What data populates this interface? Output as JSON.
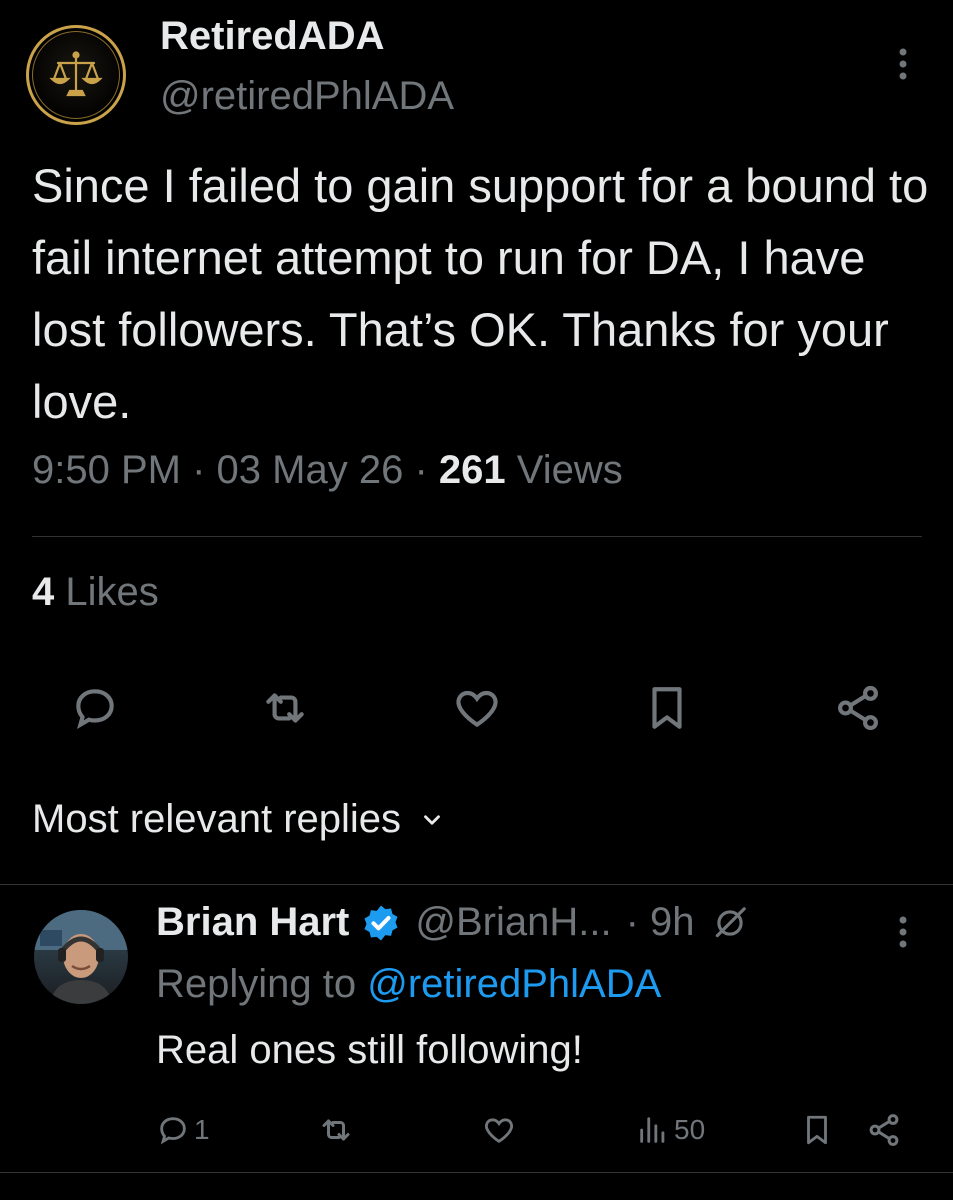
{
  "tweet": {
    "author": {
      "display_name": "RetiredADA",
      "handle": "@retiredPhlADA",
      "avatar_icon": "scales-of-justice-icon"
    },
    "text": "Since I failed to gain support for a bound to fail internet attempt to run for DA, I have lost followers.  That’s OK.  Thanks for your love.",
    "time": "9:50 PM",
    "date": "03 May 26",
    "views_count": "261",
    "views_label": "Views",
    "separator": "·",
    "likes_count": "4",
    "likes_label": "Likes",
    "actions": [
      "reply-icon",
      "retweet-icon",
      "like-icon",
      "bookmark-icon",
      "share-icon"
    ]
  },
  "replies_section": {
    "header": "Most relevant replies"
  },
  "reply": {
    "display_name": "Brian Hart",
    "handle": "@BrianH...",
    "time": "· 9h",
    "replying_prefix": "Replying to ",
    "replying_handle": "@retiredPhlADA",
    "text": "Real ones still following!",
    "reply_count": "1",
    "views_count": "50"
  },
  "colors": {
    "background": "#000000",
    "text": "#e7e9ea",
    "muted": "#71767b",
    "link": "#1d9bf0",
    "divider": "#2f3336",
    "gold": "#c9a24a"
  }
}
